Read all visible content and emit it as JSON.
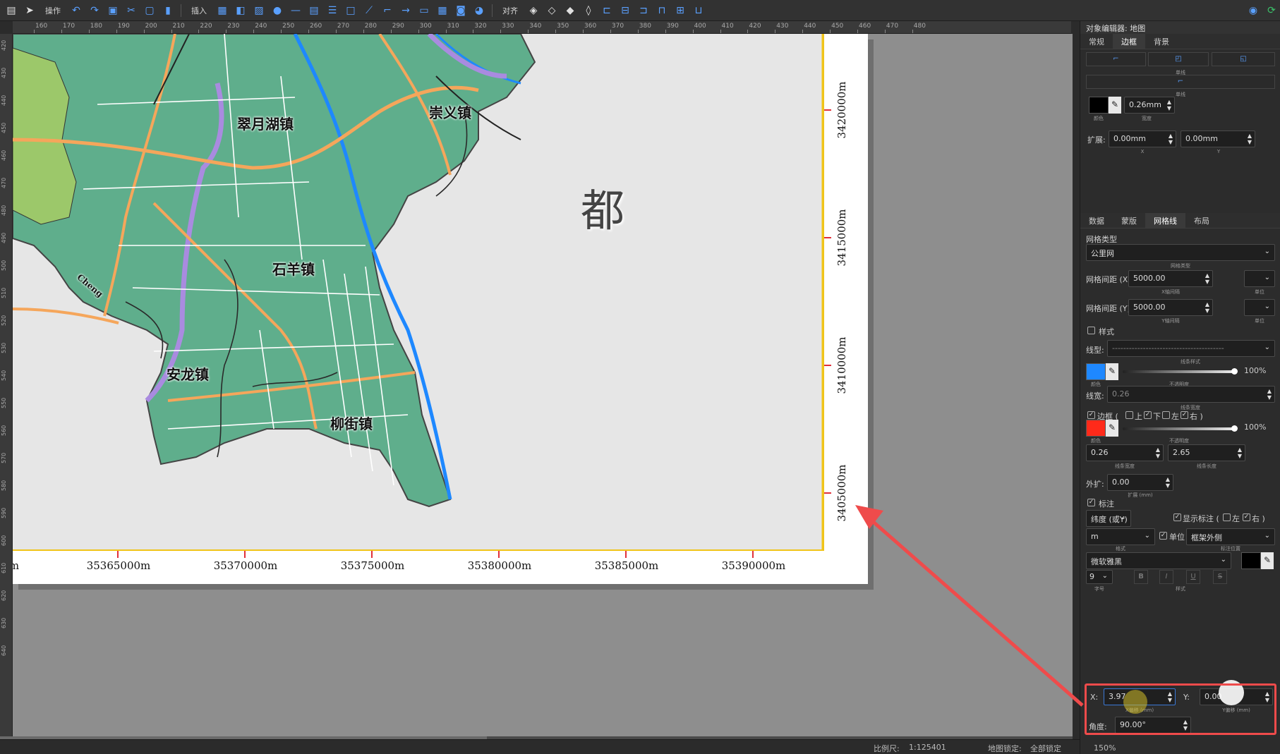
{
  "toolbar": {
    "operate_label": "操作",
    "insert_label": "插入",
    "align_label": "对齐"
  },
  "ruler_top_labels": [
    "160",
    "170",
    "180",
    "190",
    "200",
    "210",
    "220",
    "230",
    "240",
    "250",
    "260",
    "270",
    "280",
    "290",
    "300",
    "310",
    "320",
    "330",
    "340",
    "350",
    "360",
    "370",
    "380",
    "390",
    "400",
    "410",
    "420",
    "430",
    "440",
    "450",
    "460",
    "470",
    "480"
  ],
  "ruler_left_labels": [
    "420",
    "430",
    "440",
    "450",
    "460",
    "470",
    "480",
    "490",
    "500",
    "510",
    "520",
    "530",
    "540",
    "550",
    "560",
    "570",
    "580",
    "590",
    "600",
    "610",
    "620",
    "630",
    "640"
  ],
  "map": {
    "x_labels": [
      "m",
      "35365000m",
      "35370000m",
      "35375000m",
      "35380000m",
      "35385000m",
      "35390000m"
    ],
    "y_labels": [
      "3420000m",
      "3415000m",
      "3410000m",
      "3405000m"
    ],
    "towns": [
      "崇义镇",
      "翠月湖镇",
      "石羊镇",
      "安龙镇",
      "柳街镇"
    ],
    "big_char": "都",
    "river_label": "Cheng"
  },
  "status": {
    "scale_label": "比例尺:",
    "scale_value": "1:125401",
    "lock_label": "地图锁定:",
    "lock_value": "全部锁定",
    "zoom_value": "150%"
  },
  "panel": {
    "title": "对象编辑器: 地图",
    "top_tabs": [
      "常规",
      "边框",
      "背景"
    ],
    "line_caption_1": "单线",
    "line_caption_2": "单线",
    "border_color_label": "颜色",
    "border_width": "0.26mm",
    "border_width_label": "宽度",
    "expand_label": "扩展:",
    "expand_x": "0.00mm",
    "expand_x_label": "X",
    "expand_y": "0.00mm",
    "expand_y_label": "Y",
    "bottom_tabs": [
      "数据",
      "蒙版",
      "网格线",
      "布局"
    ],
    "grid_type_heading": "网格类型",
    "grid_type_value": "公里网",
    "grid_type_caption": "网格类型",
    "grid_x_label": "网格间距 (X)",
    "grid_x_value": "5000.00",
    "grid_x_caption": "X轴间隔",
    "grid_x_unit_caption": "单位",
    "grid_y_label": "网格间距 (Y)",
    "grid_y_value": "5000.00",
    "grid_y_caption": "Y轴间隔",
    "grid_y_unit_caption": "单位",
    "style_label": "样式",
    "linetype_label": "线型:",
    "linetype_caption": "线条样式",
    "line_color_caption": "颜色",
    "opacity_caption": "不透明度",
    "opacity_value": "100%",
    "linewidth_label": "线宽:",
    "linewidth_value": "0.26",
    "linewidth_caption": "线条宽度",
    "frame_label": "边框 (",
    "frame_top": "上",
    "frame_bottom": "下",
    "frame_left": "左",
    "frame_right": "右 )",
    "frame_color_caption": "颜色",
    "frame_opacity_caption": "不透明度",
    "frame_opacity_value": "100%",
    "frame_width_value": "0.26",
    "frame_width_caption": "线条宽度",
    "frame_length_value": "2.65",
    "frame_length_caption": "线条长度",
    "outer_label": "外扩:",
    "outer_value": "0.00",
    "outer_caption": "扩展 (mm)",
    "annotation_label": "标注",
    "annotation_type": "纬度 (或Y)",
    "show_label": "显示标注 (",
    "show_left": "左",
    "show_right": "右 )",
    "unit_value": "m",
    "unit_check_label": "单位",
    "position_value": "框架外侧",
    "format_caption": "格式",
    "position_caption": "标注位置",
    "font_value": "微软雅黑",
    "font_size": "9",
    "fontsize_caption": "字号",
    "fontstyle_caption": "样式",
    "style_b": "B",
    "style_i": "I",
    "style_u": "U",
    "style_s": "S",
    "x_label": "X:",
    "x_value": "3.97",
    "x_caption": "X偏移 (mm)",
    "y_label": "Y:",
    "y_value": "0.00",
    "y_caption": "Y偏移 (mm)",
    "angle_label": "角度:",
    "angle_value": "90.00°"
  },
  "colors": {
    "land": "#5fae8c",
    "water": "#e6e6e6",
    "road": "#f5a65b",
    "metro": "#a98be0",
    "grid_line": "#1e88ff",
    "frame_line": "#ff2a1a",
    "highlight": "#ef4b4b",
    "border_black": "#000000",
    "font_color": "#000000"
  }
}
